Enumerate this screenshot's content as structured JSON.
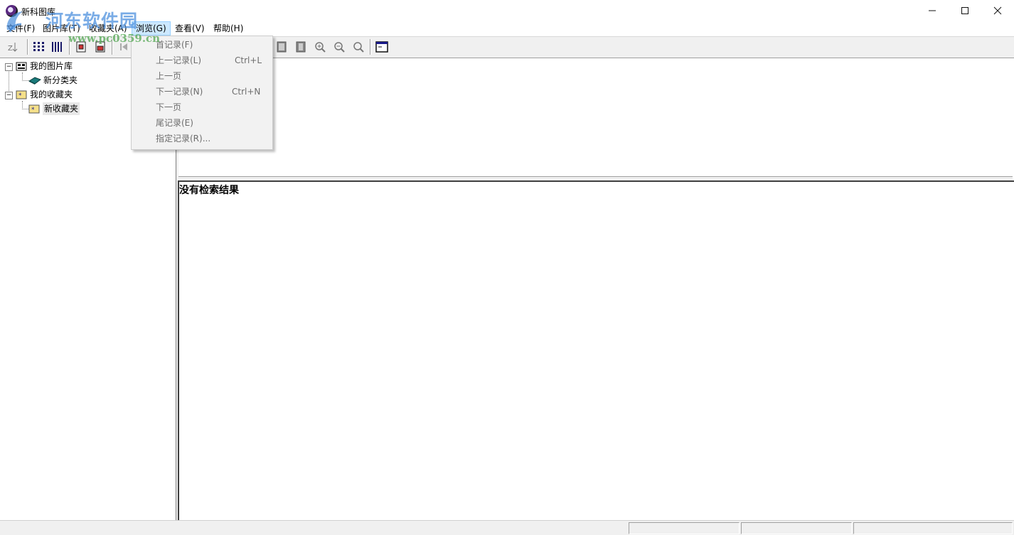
{
  "window": {
    "title": "新科图库"
  },
  "menubar": {
    "items": [
      {
        "label": "文件(F)"
      },
      {
        "label": "图片库(T)"
      },
      {
        "label": "收藏夹(A)"
      },
      {
        "label": "浏览(G)"
      },
      {
        "label": "查看(V)"
      },
      {
        "label": "帮助(H)"
      }
    ]
  },
  "browse_menu": {
    "items": [
      {
        "label": "首记录(F)",
        "shortcut": ""
      },
      {
        "label": "上一记录(L)",
        "shortcut": "Ctrl+L"
      },
      {
        "label": "上一页",
        "shortcut": ""
      },
      {
        "label": "下一记录(N)",
        "shortcut": "Ctrl+N"
      },
      {
        "label": "下一页",
        "shortcut": ""
      },
      {
        "label": "尾记录(E)",
        "shortcut": ""
      },
      {
        "label": "指定记录(R)...",
        "shortcut": ""
      }
    ]
  },
  "tree": {
    "items": [
      {
        "label": "我的图片库"
      },
      {
        "label": "新分类夹"
      },
      {
        "label": "我的收藏夹"
      },
      {
        "label": "新收藏夹"
      }
    ]
  },
  "results": {
    "empty_text": "没有检索结果"
  },
  "watermark": {
    "site_name": "河东软件园",
    "url": "www.pc0359.cn"
  },
  "colors": {
    "menu_highlight": "#cce8ff",
    "chrome": "#f0f0f0",
    "watermark": "#468cdc"
  }
}
